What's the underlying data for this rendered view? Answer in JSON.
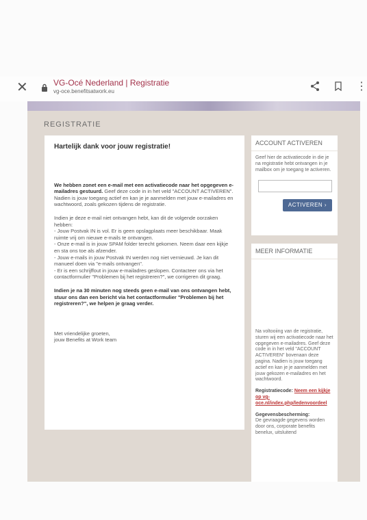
{
  "browser": {
    "tab_title": "VG-Océ Nederland | Registratie",
    "url": "vg-oce.benefitsatwork.eu"
  },
  "page": {
    "heading": "REGISTRATIE"
  },
  "main": {
    "title": "Hartelijk dank voor jouw registratie!",
    "p1_bold": "We hebben zonet een e-mail met een activatiecode naar het opgegeven e-mailadres gestuurd.",
    "p1_text": " Geef deze code in in het veld \"ACCOUNT ACTIVEREN\". Nadien is jouw toegang actief en kan je je aanmelden met jouw e-mailadres en wachtwoord, zoals gekozen tijdens de registratie.",
    "p2": "Indien je deze e-mail niet ontvangen hebt, kan dit de volgende oorzaken hebben:",
    "reason1": "- Jouw Postvak IN is vol. Er is geen opslagplaats meer beschikbaar. Maak ruimte vrij om nieuwe e-mails te ontvangen.",
    "reason2": "- Onze e-mail is in jouw SPAM folder terecht gekomen. Neem daar een kijkje en sta ons toe als afzender.",
    "reason3": "- Jouw e-mails in jouw Postvak IN werden nog niet vernieuwd. Je kan dit manueel doen via \"e-mails ontvangen\".",
    "reason4": "- Er is een schrijffout in jouw e-mailadres geslopen. Contacteer ons via het contactformulier \"Problemen bij het registreren?\", we corrigeren dit graag.",
    "p3": "Indien je na 30 minuten nog steeds geen e-mail van ons ontvangen hebt, stuur ons dan een bericht via het contactformulier \"Problemen bij het registreren?\", we helpen je graag verder.",
    "closing1": "Met vriendelijke groeten,",
    "closing2": "jouw Benefits at Work team"
  },
  "activate": {
    "title": "ACCOUNT ACTIVEREN",
    "text": "Geef hier de activatiecode in die je na registratie hebt ontvangen in je mailbox om je toegang te activeren.",
    "input_value": "",
    "button": "ACTIVEREN ›"
  },
  "info": {
    "title": "MEER INFORMATIE",
    "text": "Na voltooiing van de registratie, sturen wij een activatiecode naar het opgegeven e-mailadres. Geef deze code in in het veld \"ACCOUNT ACTIVEREN\" bovenaan deze pagina. Nadien is jouw toegang actief en kan je je aanmelden met jouw gekozen e-mailadres en het wachtwoord.",
    "reg_label": "Registratiecode:",
    "reg_link": "Neem een kijkje op vg-oce.nl/index.php/ledenvoordeel",
    "privacy_label": "Gegevensbescherming:",
    "privacy_text": "De gevraagde gegevens worden door ons, corporate benefits benelux, uitsluitend"
  }
}
